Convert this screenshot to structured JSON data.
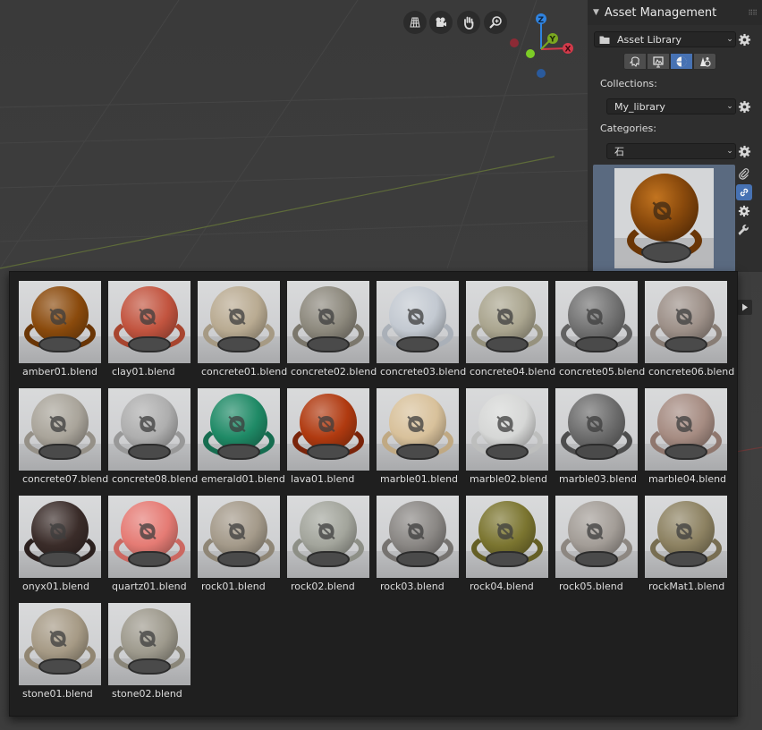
{
  "panel": {
    "title": "Asset Management",
    "library_dropdown": "Asset Library",
    "collections_label": "Collections:",
    "collections_value": "My_library",
    "categories_label": "Categories:",
    "categories_value": "石"
  },
  "colors": {
    "accent": "#4772b3",
    "panel_bg": "#2e2e2e",
    "popup_bg": "#1f1f1f",
    "viewport_bg": "#3d3d3d"
  },
  "mode_icons": [
    "object-icon",
    "scene-icon",
    "material-icon",
    "world-icon"
  ],
  "assets": [
    {
      "name": "amber01.blend",
      "color": "#8a4a0c",
      "ring": "#6a3606"
    },
    {
      "name": "clay01.blend",
      "color": "#c2543f",
      "ring": "#a8452f"
    },
    {
      "name": "concrete01.blend",
      "color": "#b9ab92",
      "ring": "#a69a84"
    },
    {
      "name": "concrete02.blend",
      "color": "#8d897d",
      "ring": "#7b776c"
    },
    {
      "name": "concrete03.blend",
      "color": "#c3c9d1",
      "ring": "#aab0b8"
    },
    {
      "name": "concrete04.blend",
      "color": "#aaa58f",
      "ring": "#96927e"
    },
    {
      "name": "concrete05.blend",
      "color": "#727272",
      "ring": "#626262"
    },
    {
      "name": "concrete06.blend",
      "color": "#9d9088",
      "ring": "#887d75"
    },
    {
      "name": "concrete07.blend",
      "color": "#a9a49a",
      "ring": "#959087"
    },
    {
      "name": "concrete08.blend",
      "color": "#aeaeae",
      "ring": "#989898"
    },
    {
      "name": "emerald01.blend",
      "color": "#1f8a66",
      "ring": "#166d50"
    },
    {
      "name": "lava01.blend",
      "color": "#b03a10",
      "ring": "#7a240a"
    },
    {
      "name": "marble01.blend",
      "color": "#d8c19b",
      "ring": "#c0a983"
    },
    {
      "name": "marble02.blend",
      "color": "#d6d7d6",
      "ring": "#bdbebd"
    },
    {
      "name": "marble03.blend",
      "color": "#6c6c6c",
      "ring": "#4d4d4d"
    },
    {
      "name": "marble04.blend",
      "color": "#a68c82",
      "ring": "#8f776e"
    },
    {
      "name": "onyx01.blend",
      "color": "#3a2c29",
      "ring": "#2c211f"
    },
    {
      "name": "quartz01.blend",
      "color": "#e57b74",
      "ring": "#cc6861"
    },
    {
      "name": "rock01.blend",
      "color": "#a49a8a",
      "ring": "#8f8676"
    },
    {
      "name": "rock02.blend",
      "color": "#a3a59c",
      "ring": "#8d8f86"
    },
    {
      "name": "rock03.blend",
      "color": "#8a8784",
      "ring": "#767370"
    },
    {
      "name": "rock04.blend",
      "color": "#7b7530",
      "ring": "#655f25"
    },
    {
      "name": "rock05.blend",
      "color": "#a39d97",
      "ring": "#8d8781"
    },
    {
      "name": "rockMat1.blend",
      "color": "#8d8262",
      "ring": "#786e52"
    },
    {
      "name": "stone01.blend",
      "color": "#a69a85",
      "ring": "#918672"
    },
    {
      "name": "stone02.blend",
      "color": "#9e9a8d",
      "ring": "#8a8679"
    }
  ]
}
